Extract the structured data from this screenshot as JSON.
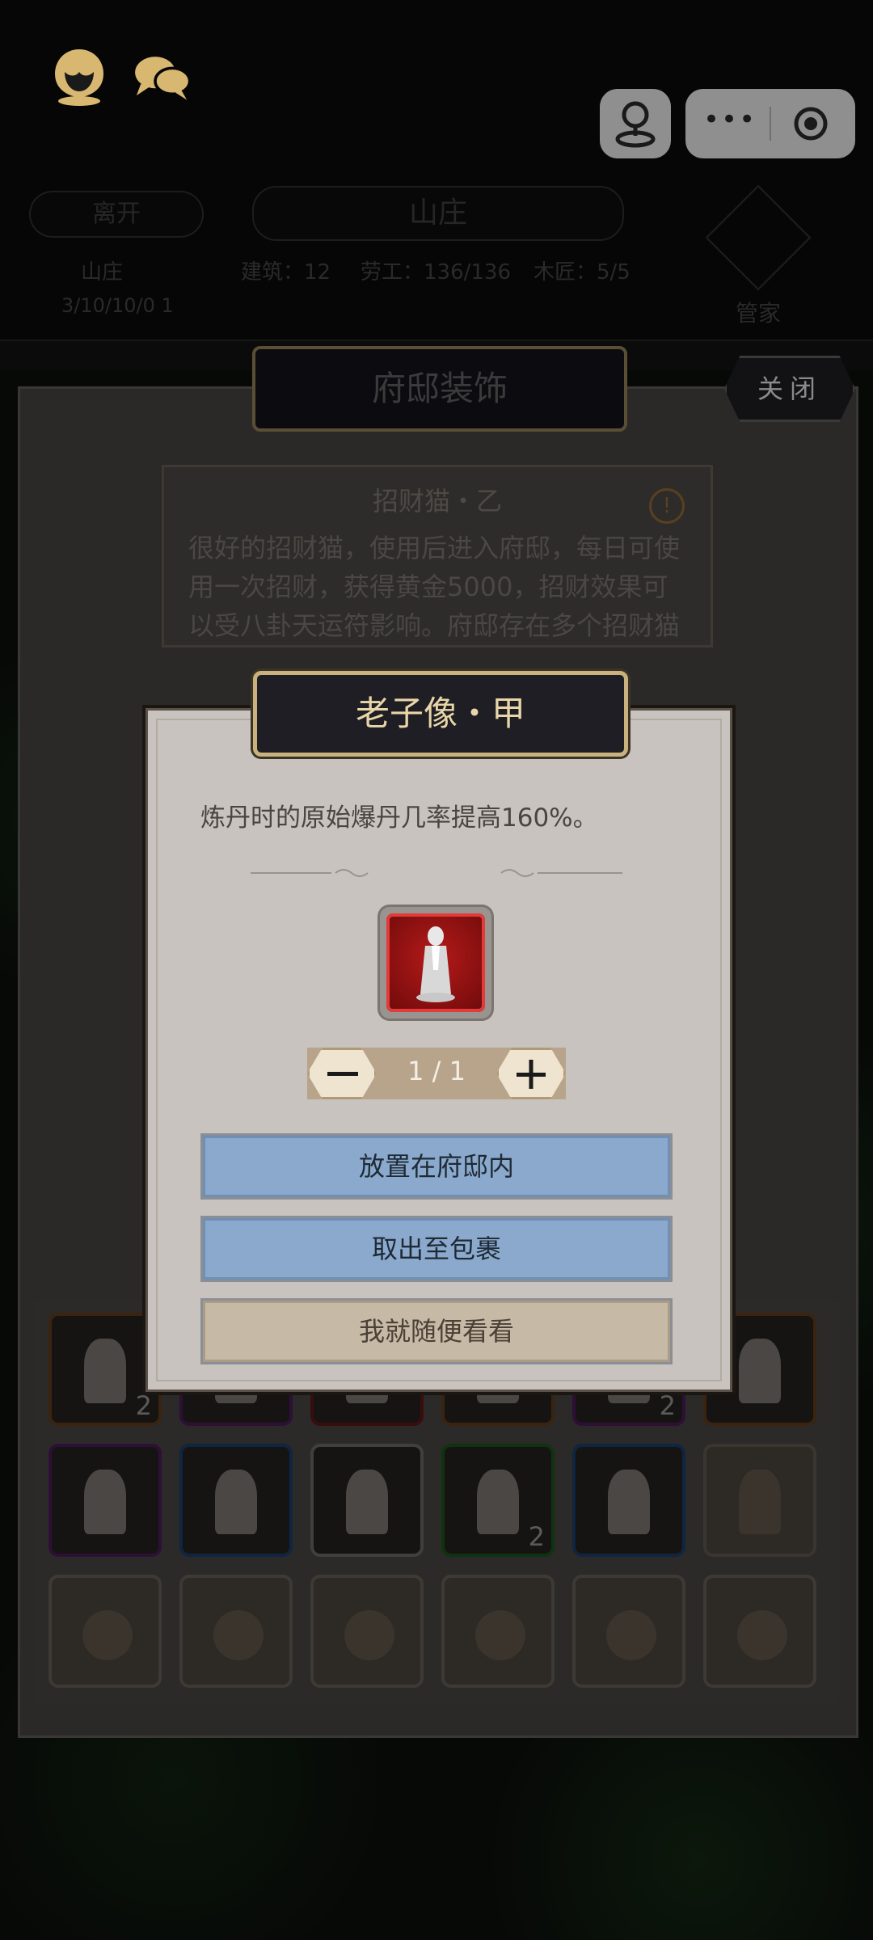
{
  "top_bar": {
    "menu_dots": "•••"
  },
  "manor_header": {
    "leave_label": "离开",
    "manor_label": "山庄",
    "building_stats": "建筑：12",
    "labor_stats": "劳工：136/136",
    "carpenter_stats": "木匠：5/5",
    "left_sub_1": "山庄",
    "left_sub_2": "3/10/10/0 1",
    "steward_label": "管家"
  },
  "panel": {
    "title": "府邸装饰",
    "close_label": "关闭",
    "desc": {
      "item_name": "招财猫・乙",
      "text": "很好的招财猫，使用后进入府邸，每日可使用一次招财，获得黄金5000，招财效果可以受八卦天运符影响。府邸存在多个招财猫"
    }
  },
  "modal": {
    "title": "老子像・甲",
    "description": "炼丹时的原始爆丹几率提高160%。",
    "quantity": "1 / 1",
    "place_button": "放置在府邸内",
    "take_out_button": "取出至包裹",
    "browse_button": "我就随便看看"
  },
  "grid": {
    "row1": [
      {
        "rarity": "orange",
        "item": "statue",
        "count": "2"
      },
      {
        "rarity": "purple",
        "item": "unknown",
        "count": ""
      },
      {
        "rarity": "red",
        "item": "unknown",
        "count": ""
      },
      {
        "rarity": "orange",
        "item": "unknown",
        "count": ""
      },
      {
        "rarity": "purple",
        "item": "unknown",
        "count": "2"
      },
      {
        "rarity": "orange",
        "item": "statue",
        "count": ""
      }
    ],
    "row2": [
      {
        "rarity": "purple",
        "item": "statue",
        "count": ""
      },
      {
        "rarity": "blue",
        "item": "lucky-cat",
        "count": ""
      },
      {
        "rarity": "white",
        "item": "lucky-cat",
        "count": ""
      },
      {
        "rarity": "green",
        "item": "lucky-cat",
        "count": "2"
      },
      {
        "rarity": "blue",
        "item": "statue",
        "count": ""
      },
      {
        "rarity": "empty",
        "item": "bag",
        "count": ""
      }
    ]
  },
  "colors": {
    "orange": "#8a4a12",
    "purple": "#6a1f78",
    "red": "#7a1616",
    "blue": "#1f4a7a",
    "green": "#1f6a1f",
    "white": "#8a8a8a",
    "modal_bg": "#c8c3bf",
    "gold": "#c9b27d"
  }
}
